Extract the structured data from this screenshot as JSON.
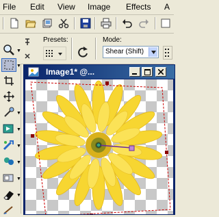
{
  "menu": {
    "file": "File",
    "edit": "Edit",
    "view": "View",
    "image": "Image",
    "effects": "Effects",
    "more": "A"
  },
  "options": {
    "presets_label": "Presets:",
    "mode_label": "Mode:",
    "mode_value": "Shear (Shift)"
  },
  "image_window": {
    "title": "Image1* @..."
  },
  "colors": {
    "title_bar": "#0a246a",
    "petal": "#f7d631",
    "center": "#8a8a1c",
    "handle": "#c08ad6",
    "bbox": "#cc0000"
  },
  "icons": [
    "new-icon",
    "open-icon",
    "browse-icon",
    "cut-icon",
    "save-icon",
    "print-icon",
    "undo-icon",
    "redo-icon",
    "zoom-icon",
    "pin-icon",
    "presets-grid-icon",
    "rotate-icon",
    "mode-grid-icon",
    "selection-icon",
    "crop-icon",
    "move-icon",
    "dropper-icon",
    "color-replace-icon",
    "picture-tube-icon",
    "clone-icon",
    "background-eraser-icon",
    "eraser-icon",
    "paint-brush-icon",
    "flower-image",
    "pick-handle-icon"
  ]
}
